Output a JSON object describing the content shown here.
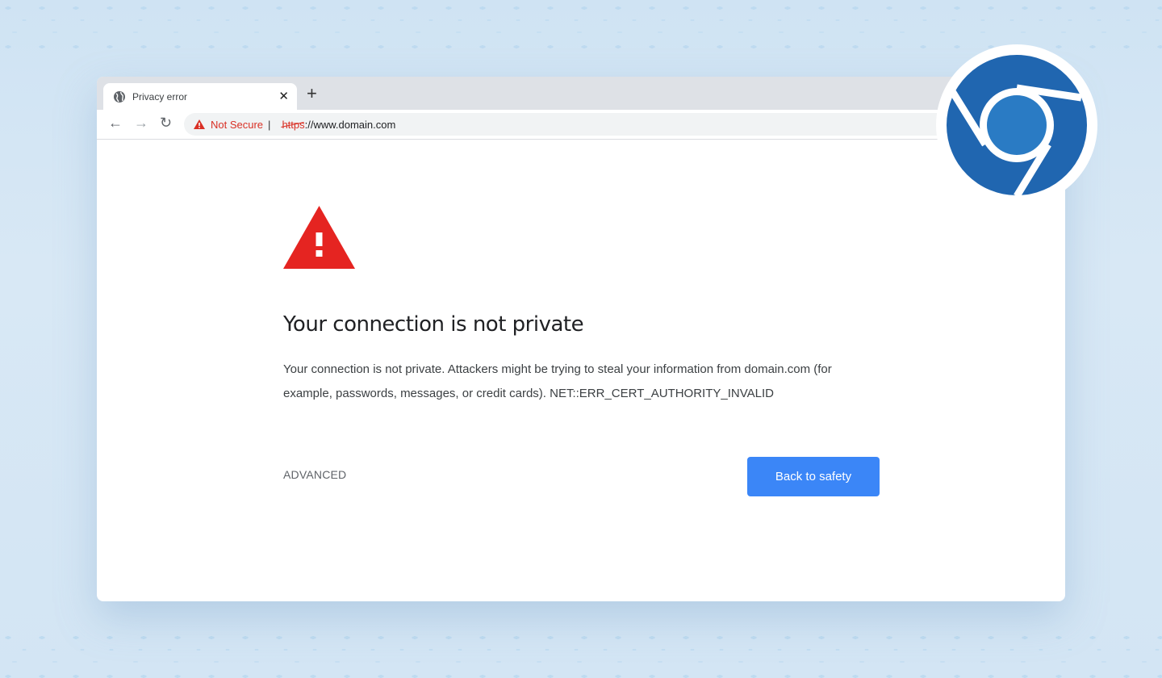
{
  "browser": {
    "tab": {
      "title": "Privacy error",
      "icon": "globe-icon",
      "close_icon": "close-icon"
    },
    "new_tab_label": "+",
    "nav": {
      "back_icon": "arrow-left-icon",
      "forward_icon": "arrow-right-icon",
      "reload_icon": "reload-icon"
    },
    "omnibox": {
      "security_label": "Not Secure",
      "separator": "|",
      "scheme": "https",
      "rest": "://www.domain.com"
    }
  },
  "page": {
    "heading": "Your connection is not private",
    "description": "Your connection is not private. Attackers might be trying to steal your information from domain.com (for example, passwords, messages, or credit cards). NET::ERR_CERT_AUTHORITY_INVALID",
    "advanced_label": "ADVANCED",
    "back_button_label": "Back to safety"
  },
  "colors": {
    "danger": "#e52421",
    "accent": "#3b86f7",
    "logo_blue": "#2066b0"
  }
}
